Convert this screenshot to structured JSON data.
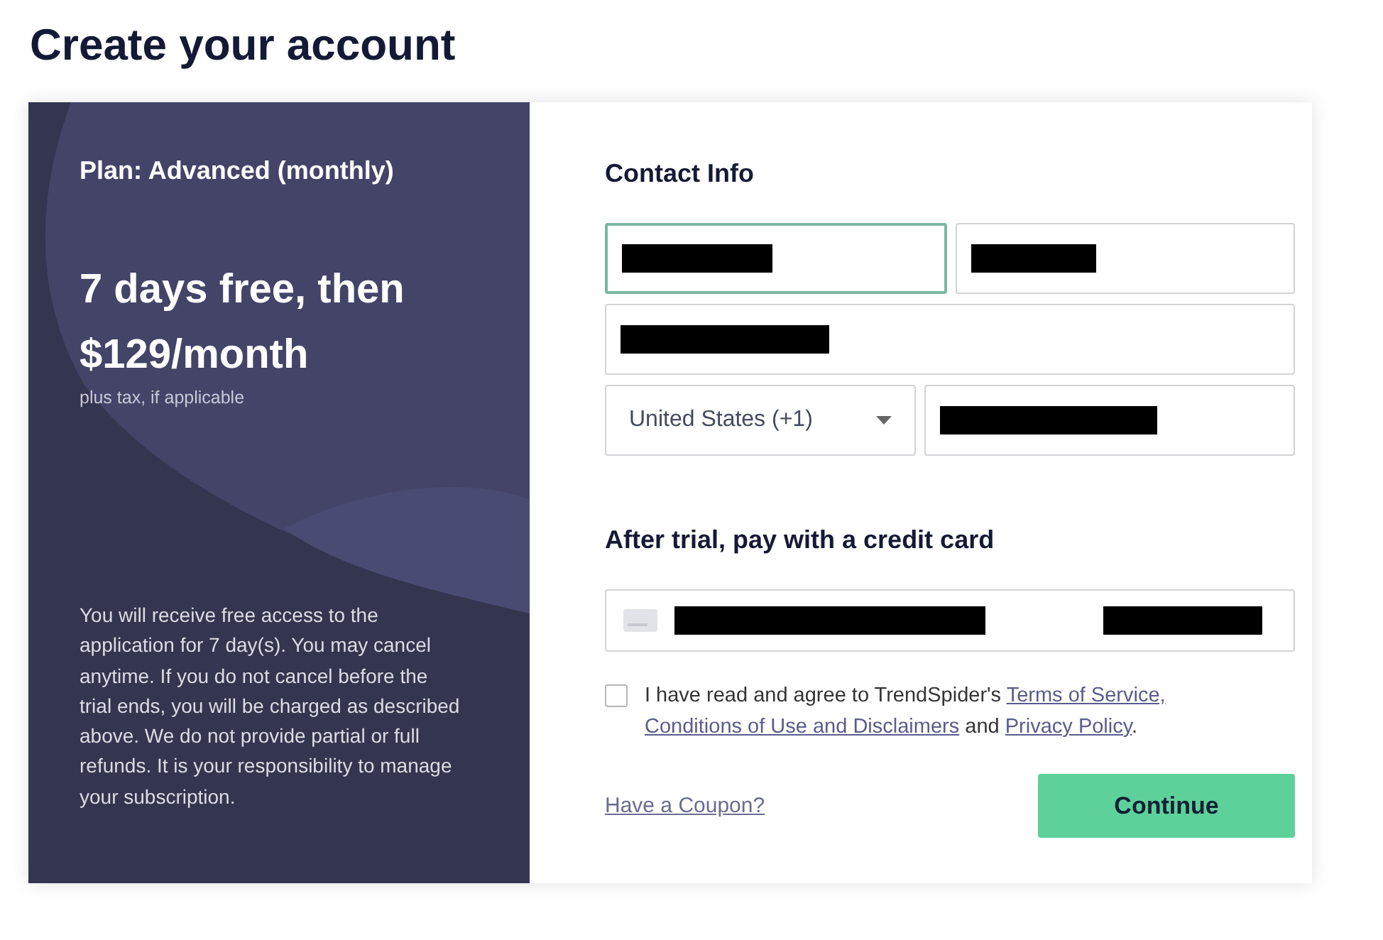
{
  "page_title": "Create your account",
  "plan": {
    "name": "Plan: Advanced (monthly)",
    "price_line_1": "7 days free, then",
    "price_line_2": "$129/month",
    "tax_note": "plus tax, if applicable",
    "disclaimer": "You will receive free access to the application for 7 day(s). You may cancel anytime. If you do not cancel before the trial ends, you will be charged as described above. We do not provide partial or full refunds. It is your responsibility to manage your subscription."
  },
  "contact": {
    "heading": "Contact Info",
    "fields": [
      {
        "focused": true,
        "redacted": true
      },
      {
        "focused": false,
        "redacted": true
      },
      {
        "focused": false,
        "redacted": true
      }
    ],
    "country_select": {
      "value": "United States (+1)"
    },
    "phone_field": {
      "focused": false,
      "redacted": true
    }
  },
  "payment": {
    "heading": "After trial, pay with a credit card",
    "card_field": {
      "redacted": true
    }
  },
  "agreement": {
    "checked": false,
    "parts": [
      {
        "kind": "text",
        "text": "I have read and agree to TrendSpider's "
      },
      {
        "kind": "link",
        "text": "Terms of Service,"
      },
      {
        "kind": "line_break"
      },
      {
        "kind": "link",
        "text": "Conditions of Use and Disclaimers"
      },
      {
        "kind": "text",
        "text": " and "
      },
      {
        "kind": "link",
        "text": "Privacy Policy"
      },
      {
        "kind": "text",
        "text": "."
      }
    ]
  },
  "coupon_link": "Have a Coupon?",
  "continue_button": "Continue"
}
